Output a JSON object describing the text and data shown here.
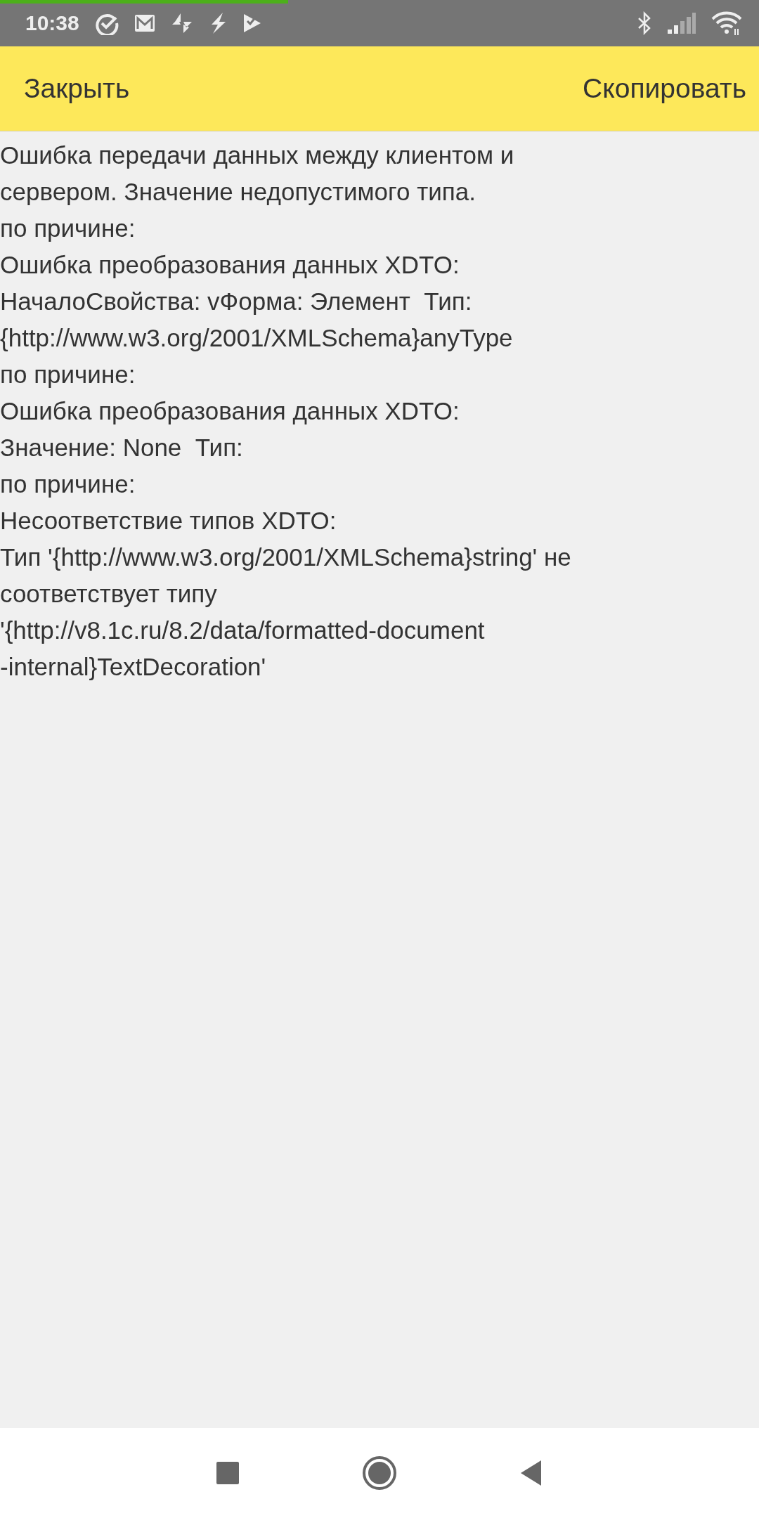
{
  "status_bar": {
    "time": "10:38",
    "progress": {
      "level": 0.38
    }
  },
  "toolbar": {
    "buttons": [
      {
        "label": "Закрыть"
      },
      {
        "label": "Скопировать"
      }
    ]
  },
  "message": {
    "lines": [
      "Ошибка передачи данных между клиентом и",
      "сервером. Значение недопустимого типа.",
      "по причине:",
      "Ошибка преобразования данных XDTO:",
      "НачалоСвойства: vФорма: Элемент  Тип:",
      "{http://www.w3.org/2001/XMLSchema}anyType",
      "по причине:",
      "Ошибка преобразования данных XDTO:",
      "Значение: None  Тип:",
      "по причине:",
      "Несоответствие типов XDTO:",
      "Тип '{http://www.w3.org/2001/XMLSchema}string' не",
      "соответствует типу",
      "'{http://v8.1c.ru/8.2/data/formatted-document",
      "-internal}TextDecoration'"
    ]
  }
}
